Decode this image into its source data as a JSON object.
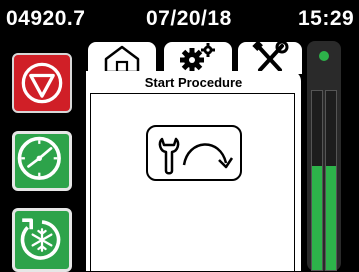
{
  "status_bar": {
    "hour_meter": "04920.7",
    "date": "07/20/18",
    "time": "15:29"
  },
  "left_buttons": [
    {
      "icon": "stop-icon",
      "color": "#d01f27"
    },
    {
      "icon": "continuous-mode-icon",
      "color": "#2da34a"
    },
    {
      "icon": "defrost-icon",
      "color": "#2da34a"
    }
  ],
  "tabs": [
    {
      "icon": "home-icon"
    },
    {
      "icon": "settings-gears-icon"
    },
    {
      "icon": "tools-icon",
      "active": true
    }
  ],
  "panel": {
    "title": "Start Procedure",
    "action_icon": "wrench-restart-icon"
  },
  "side_panel": {
    "status_color": "#2db34a",
    "gauges": [
      {
        "level": 0.58
      },
      {
        "level": 0.58
      }
    ]
  }
}
